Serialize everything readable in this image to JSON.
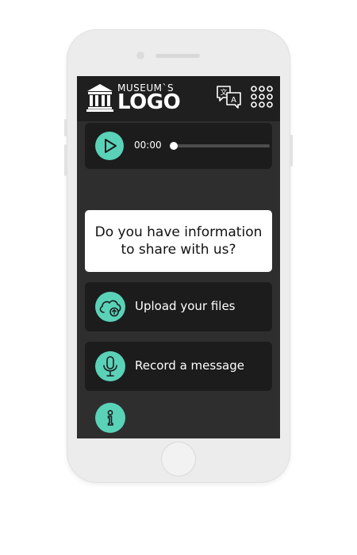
{
  "colors": {
    "accent": "#5ad2b8",
    "screen_bg": "#2e2e2e",
    "header_bg": "#1f1f1f",
    "card_bg": "#1c1c1c"
  },
  "header": {
    "logo_top": "MUSEUM`S",
    "logo_main": "LOGO",
    "icons": [
      "museum-building-icon",
      "translate-icon",
      "apps-grid-icon"
    ]
  },
  "audio_player": {
    "time": "00:00",
    "progress": 0
  },
  "prompt": {
    "question": "Do you have information to share with us?"
  },
  "actions": {
    "upload": {
      "label": "Upload your files",
      "icon": "cloud-upload-icon"
    },
    "record": {
      "label": "Record a message",
      "icon": "microphone-icon"
    }
  },
  "footer": {
    "info_icon": "info-icon"
  }
}
